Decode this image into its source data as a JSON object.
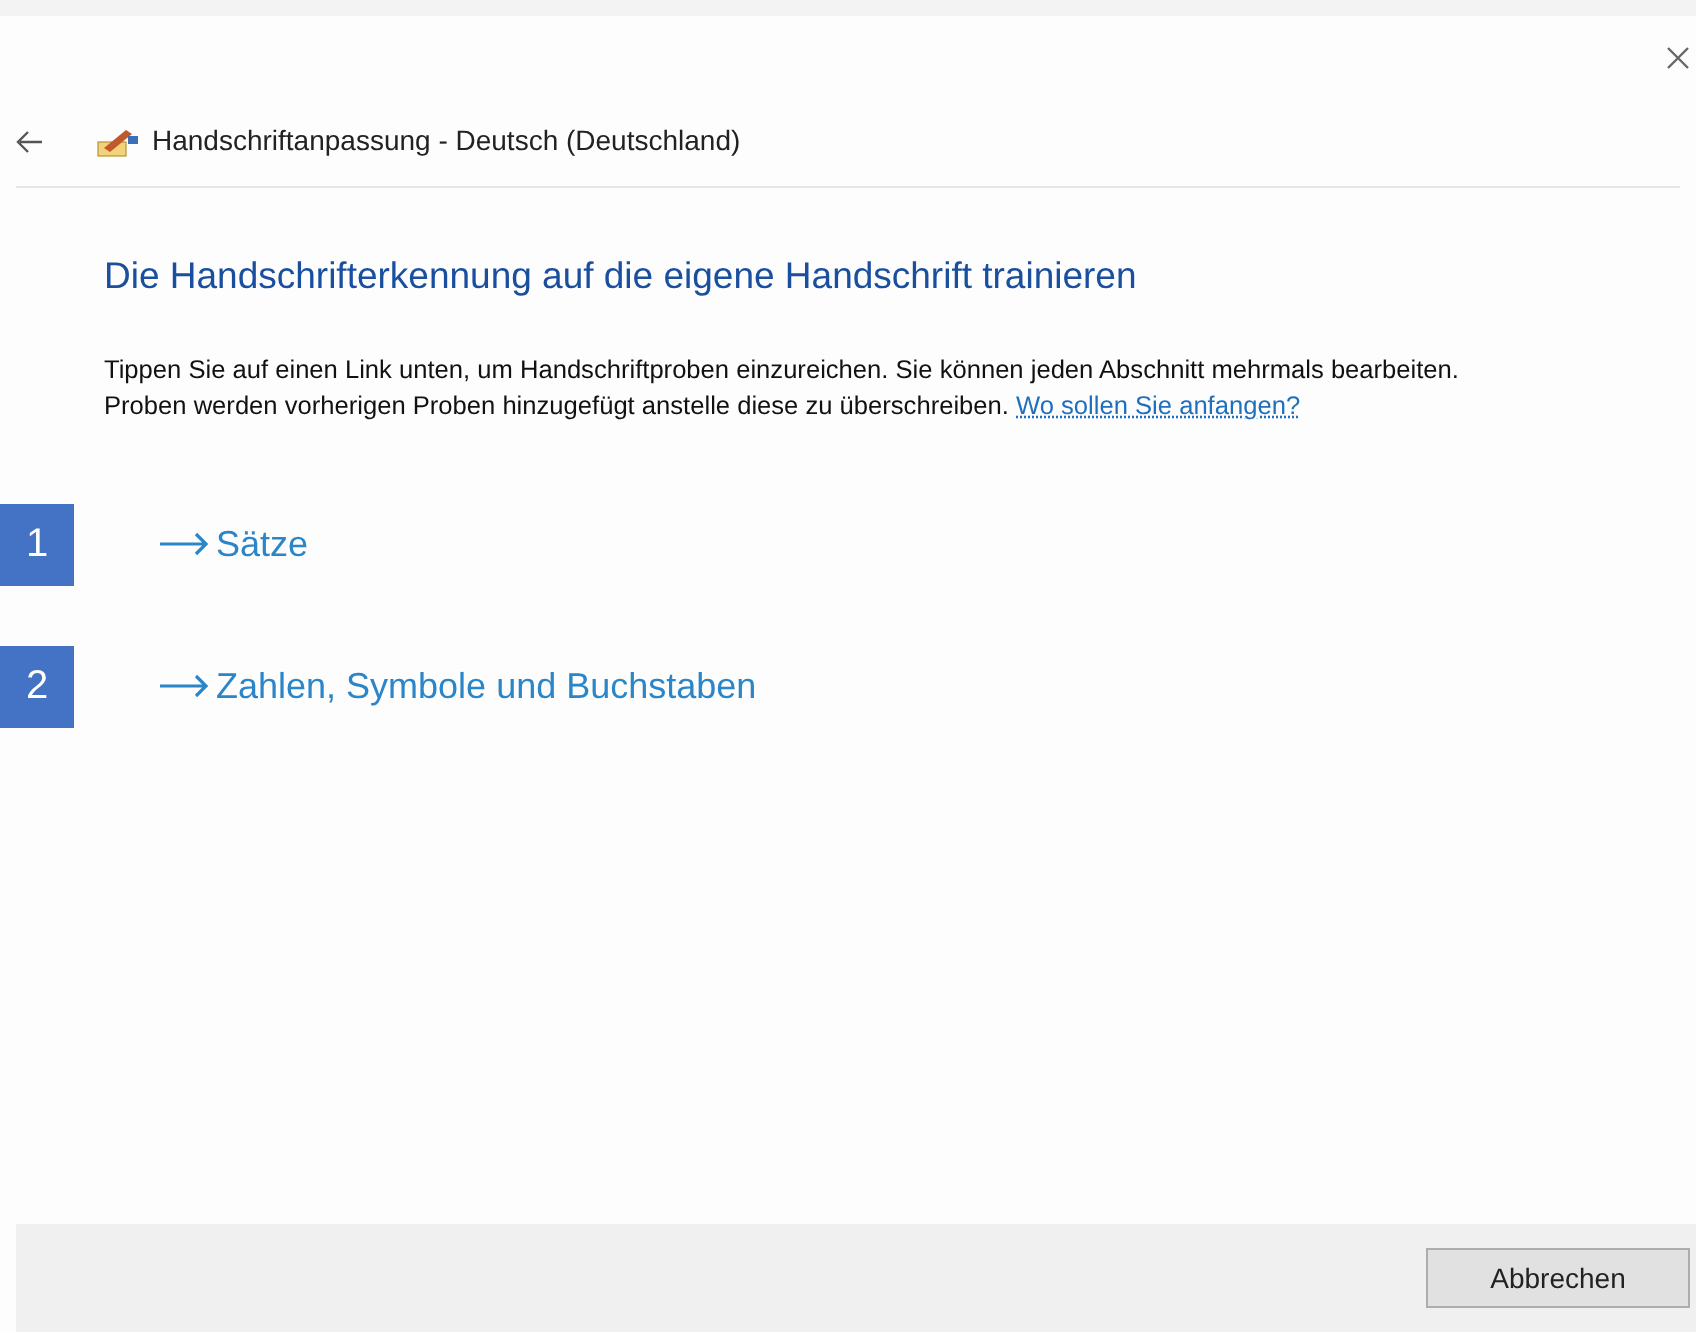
{
  "window": {
    "title": "Handschriftanpassung - Deutsch (Deutschland)"
  },
  "heading": "Die Handschrifterkennung auf die eigene Handschrift trainieren",
  "intro": {
    "text": "Tippen Sie auf einen Link unten, um Handschriftproben einzureichen. Sie können jeden Abschnitt mehrmals bearbeiten. Proben werden vorherigen Proben hinzugefügt anstelle diese zu überschreiben.",
    "link": "Wo sollen Sie anfangen?"
  },
  "links": [
    {
      "badge": "1",
      "label": "Sätze"
    },
    {
      "badge": "2",
      "label": "Zahlen, Symbole und Buchstaben"
    }
  ],
  "buttons": [
    "Abbrechen"
  ]
}
